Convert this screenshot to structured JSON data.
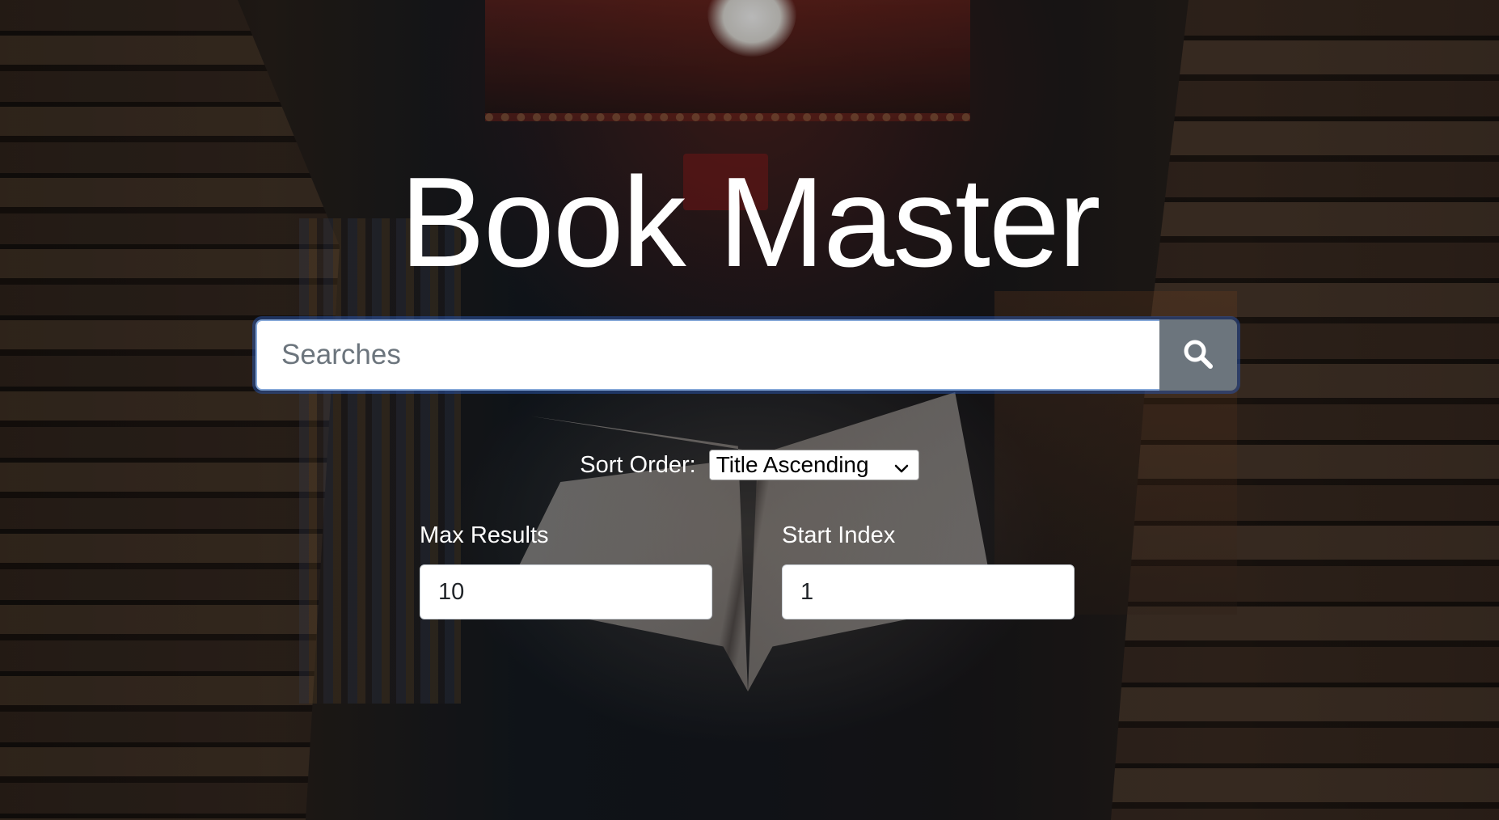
{
  "app": {
    "title": "Book Master"
  },
  "search": {
    "placeholder": "Searches",
    "value": "",
    "button_icon": "search-icon"
  },
  "sort": {
    "label": "Sort Order:",
    "selected": "Title Ascending",
    "icon": "chevron-down-icon"
  },
  "max_results": {
    "label": "Max Results",
    "value": "10"
  },
  "start_index": {
    "label": "Start Index",
    "value": "1"
  },
  "colors": {
    "title_text": "#ffffff",
    "search_button_bg": "#6c757d",
    "input_focus_ring": "#2850a0"
  }
}
